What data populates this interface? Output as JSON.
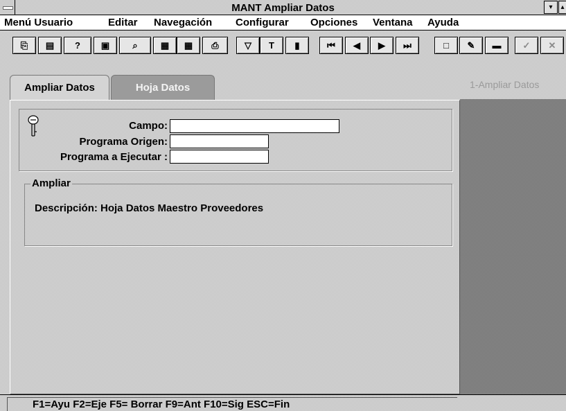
{
  "window": {
    "title": "MANT Ampliar Datos",
    "minimize_glyph": "▾",
    "restore_glyph": "▴"
  },
  "menu": [
    {
      "label": "Menú Usuario"
    },
    {
      "label": "Editar"
    },
    {
      "label": "Navegación"
    },
    {
      "label": "Configurar"
    },
    {
      "label": "Opciones"
    },
    {
      "label": "Ventana"
    },
    {
      "label": "Ayuda"
    }
  ],
  "toolbar": {
    "buttons": [
      {
        "icon": "copy-icon",
        "glyph": "⎘"
      },
      {
        "icon": "paste-icon",
        "glyph": "▤"
      },
      {
        "icon": "help-icon",
        "glyph": "?"
      },
      {
        "icon": "info-icon",
        "glyph": "▣"
      },
      {
        "icon": "search-icon",
        "glyph": "⌕"
      },
      {
        "icon": "grid-icon",
        "glyph": "▦"
      },
      {
        "icon": "calculator-icon",
        "glyph": "▦"
      },
      {
        "icon": "print-icon",
        "glyph": "⎙"
      },
      {
        "icon": "filter-icon",
        "glyph": "▽"
      },
      {
        "icon": "text-icon",
        "glyph": "T"
      },
      {
        "icon": "chart-icon",
        "glyph": "▮"
      },
      {
        "icon": "first-record-icon",
        "glyph": "⏮"
      },
      {
        "icon": "previous-record-icon",
        "glyph": "◀"
      },
      {
        "icon": "next-record-icon",
        "glyph": "▶"
      },
      {
        "icon": "last-record-icon",
        "glyph": "⏭"
      },
      {
        "icon": "new-document-icon",
        "glyph": "□"
      },
      {
        "icon": "edit-pencil-icon",
        "glyph": "✎"
      },
      {
        "icon": "delete-icon",
        "glyph": "▬"
      },
      {
        "icon": "accept-icon",
        "glyph": "✓"
      },
      {
        "icon": "cancel-icon",
        "glyph": "✕"
      }
    ]
  },
  "tabs": [
    {
      "label": "Ampliar Datos",
      "active": true
    },
    {
      "label": "Hoja Datos",
      "active": false
    }
  ],
  "form": {
    "key_icon": "key-icon",
    "campo_label": "Campo:",
    "campo_value": "",
    "programa_origen_label": "Programa Origen:",
    "programa_origen_value": "",
    "programa_ejecutar_label": "Programa a Ejecutar :",
    "programa_ejecutar_value": ""
  },
  "ampliar": {
    "title": "Ampliar",
    "description": "Descripción: Hoja Datos Maestro Proveedores"
  },
  "side_list": {
    "item": "1-Ampliar Datos"
  },
  "status": {
    "text": "F1=Ayu  F2=Eje  F5= Borrar  F9=Ant  F10=Sig  ESC=Fin"
  }
}
